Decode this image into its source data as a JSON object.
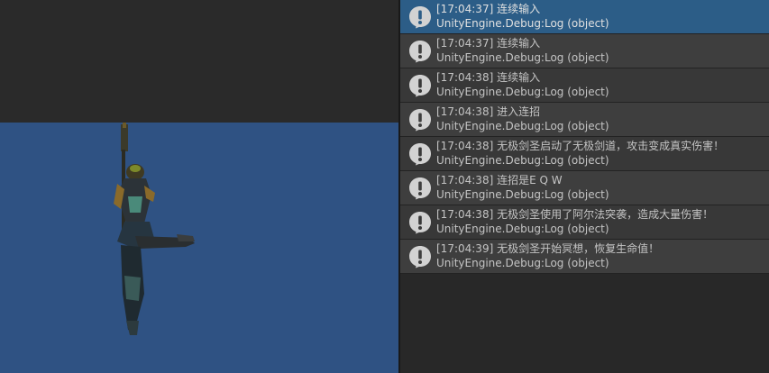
{
  "console": {
    "entries": [
      {
        "message": "[17:04:37] 连续输入",
        "source": "UnityEngine.Debug:Log (object)",
        "selected": true
      },
      {
        "message": "[17:04:37] 连续输入",
        "source": "UnityEngine.Debug:Log (object)",
        "selected": false
      },
      {
        "message": "[17:04:38] 连续输入",
        "source": "UnityEngine.Debug:Log (object)",
        "selected": false
      },
      {
        "message": "[17:04:38] 进入连招",
        "source": "UnityEngine.Debug:Log (object)",
        "selected": false
      },
      {
        "message": "[17:04:38] 无极剑圣启动了无极剑道，攻击变成真实伤害！",
        "source": "UnityEngine.Debug:Log (object)",
        "selected": false
      },
      {
        "message": "[17:04:38] 连招是E Q W",
        "source": "UnityEngine.Debug:Log (object)",
        "selected": false
      },
      {
        "message": "[17:04:38] 无极剑圣使用了阿尔法突袭，造成大量伤害！",
        "source": "UnityEngine.Debug:Log (object)",
        "selected": false
      },
      {
        "message": "[17:04:39] 无极剑圣开始冥想，恢复生命值！",
        "source": "UnityEngine.Debug:Log (object)",
        "selected": false
      }
    ],
    "icon": "info-exclamation-icon"
  },
  "colors": {
    "scene_background": "#2f5283",
    "selected_row": "#2c5d87",
    "panel_background": "#282828"
  }
}
